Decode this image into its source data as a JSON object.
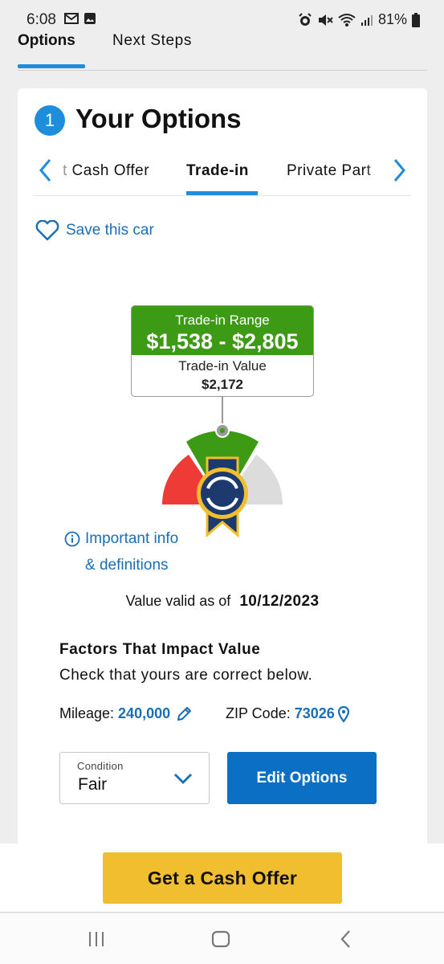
{
  "status_bar": {
    "time": "6:08",
    "battery": "81%",
    "left_icons": [
      "gmail-icon",
      "image-icon"
    ],
    "right_icons": [
      "alarm-icon",
      "mute-icon",
      "wifi-icon",
      "signal-icon",
      "battery-icon"
    ]
  },
  "top_tabs": [
    {
      "label": "Options",
      "active": true
    },
    {
      "label": "Next Steps",
      "active": false
    }
  ],
  "card": {
    "step_number": "1",
    "title": "Your Options",
    "option_tabs": [
      {
        "label": "Instant Cash Offer",
        "shown": "t Cash Offer",
        "active": false
      },
      {
        "label": "Trade-in",
        "active": true
      },
      {
        "label": "Private Party",
        "shown": "Private Part",
        "active": false
      }
    ],
    "save_label": "Save this car",
    "price": {
      "range_label": "Trade-in Range",
      "range_value": "$1,538 - $2,805",
      "value_label": "Trade-in Value",
      "value_amount": "$2,172"
    },
    "info_line1": "Important info",
    "info_line2": "& definitions",
    "valid_prefix": "Value valid as of",
    "valid_date": "10/12/2023",
    "factors_title": "Factors That Impact Value",
    "factors_sub": "Check that yours are correct below.",
    "mileage_label": "Mileage:",
    "mileage_value": "240,000",
    "zip_label": "ZIP Code:",
    "zip_value": "73026",
    "condition_label": "Condition",
    "condition_value": "Fair",
    "edit_options_label": "Edit Options"
  },
  "cta_label": "Get a Cash Offer",
  "colors": {
    "accent_blue": "#1e8ddc",
    "link_blue": "#1a6fb4",
    "button_blue": "#0b6fc4",
    "range_green": "#3d9a15",
    "cta_yellow": "#f1be30",
    "gauge_red": "#ee3b36",
    "gauge_gray": "#dcdcdc",
    "badge_navy": "#1d3a6e"
  }
}
